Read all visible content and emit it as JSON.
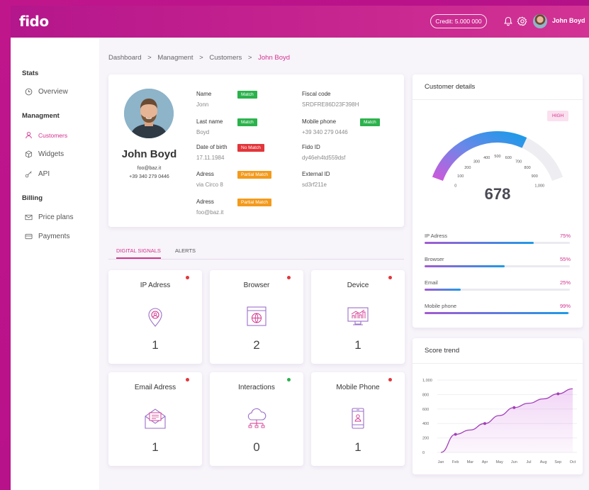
{
  "app": {
    "logo": "fido",
    "credit": "Credit: 5.000 000",
    "user_name": "John Boyd"
  },
  "sidebar": {
    "sections": [
      {
        "title": "Stats",
        "items": [
          {
            "label": "Overview",
            "icon": "clock-icon",
            "active": false
          }
        ]
      },
      {
        "title": "Managment",
        "items": [
          {
            "label": "Customers",
            "icon": "user-icon",
            "active": true
          },
          {
            "label": "Widgets",
            "icon": "cube-icon",
            "active": false
          },
          {
            "label": "API",
            "icon": "key-icon",
            "active": false
          }
        ]
      },
      {
        "title": "Billing",
        "items": [
          {
            "label": "Price plans",
            "icon": "mail-icon",
            "active": false
          },
          {
            "label": "Payments",
            "icon": "card-icon",
            "active": false
          }
        ]
      }
    ]
  },
  "breadcrumb": {
    "items": [
      "Dashboard",
      ">",
      "Managment",
      ">",
      "Customers",
      ">"
    ],
    "current": "John Boyd"
  },
  "profile": {
    "name": "John Boyd",
    "email": "foo@baz.it",
    "phone": "+39 340 279 0446",
    "fields_left": [
      {
        "label": "Name",
        "value": "Jonn",
        "badge": "Match",
        "badge_type": "match"
      },
      {
        "label": "Last name",
        "value": "Boyd",
        "badge": "Match",
        "badge_type": "match"
      },
      {
        "label": "Date of birth",
        "value": "17.11.1984",
        "badge": "No Match",
        "badge_type": "nomatch"
      },
      {
        "label": "Adress",
        "value": "via Circo 8",
        "badge": "Partial Match",
        "badge_type": "partial"
      },
      {
        "label": "Adress",
        "value": "foo@baz.it",
        "badge": "Partial Match",
        "badge_type": "partial"
      }
    ],
    "fields_right": [
      {
        "label": "Fiscal code",
        "value": "SRDFRE86D23F398H",
        "badge": ""
      },
      {
        "label": "Mobile phone",
        "value": "+39 340 279 0446",
        "badge": "Match",
        "badge_type": "match"
      },
      {
        "label": "Fido ID",
        "value": "dy46eh4td559dsf",
        "badge": ""
      },
      {
        "label": "External ID",
        "value": "sd3rf211e",
        "badge": ""
      }
    ]
  },
  "tabs": [
    {
      "label": "DIGITAL SIGNALS",
      "active": true
    },
    {
      "label": "ALERTS",
      "active": false
    }
  ],
  "signals": [
    {
      "title": "IP Adress",
      "value": "1",
      "status_color": "#e2363b",
      "icon": "location-pin-icon"
    },
    {
      "title": "Browser",
      "value": "2",
      "status_color": "#e2363b",
      "icon": "browser-globe-icon"
    },
    {
      "title": "Device",
      "value": "1",
      "status_color": "#e2363b",
      "icon": "monitor-chart-icon"
    },
    {
      "title": "Email Adress",
      "value": "1",
      "status_color": "#e2363b",
      "icon": "envelope-icon"
    },
    {
      "title": "Interactions",
      "value": "0",
      "status_color": "#2bb24c",
      "icon": "cloud-network-icon"
    },
    {
      "title": "Mobile Phone",
      "value": "1",
      "status_color": "#e2363b",
      "icon": "smartphone-icon"
    }
  ],
  "customer_details": {
    "title": "Customer details",
    "risk": "HIGH",
    "score": "678",
    "gauge_ticks": [
      "0",
      "100",
      "200",
      "300",
      "400",
      "500",
      "600",
      "700",
      "800",
      "900",
      "1,000"
    ],
    "gauge_max": 1000,
    "metrics": [
      {
        "label": "IP Adress",
        "pct": "75%",
        "fraction": 0.75
      },
      {
        "label": "Browser",
        "pct": "55%",
        "fraction": 0.55
      },
      {
        "label": "Email",
        "pct": "25%",
        "fraction": 0.25
      },
      {
        "label": "Mobile phone",
        "pct": "99%",
        "fraction": 0.99
      }
    ]
  },
  "score_trend": {
    "title": "Score trend",
    "chart_data": {
      "type": "area",
      "categories": [
        "Jan",
        "Feb",
        "Mar",
        "Apr",
        "May",
        "Jun",
        "Jul",
        "Aug",
        "Sep",
        "Oct"
      ],
      "values": [
        0,
        250,
        310,
        400,
        510,
        620,
        680,
        740,
        810,
        880
      ],
      "marked_points": [
        1,
        3,
        5,
        8
      ],
      "yticks": [
        "0",
        "200",
        "400",
        "600",
        "800",
        "1,000"
      ],
      "ylim": [
        0,
        1000
      ],
      "grid": true
    }
  },
  "colors": {
    "accent": "#d2338e",
    "brand": "#b4168c",
    "match": "#2bb24c",
    "nomatch": "#e2363b",
    "partial": "#f39a1c"
  }
}
